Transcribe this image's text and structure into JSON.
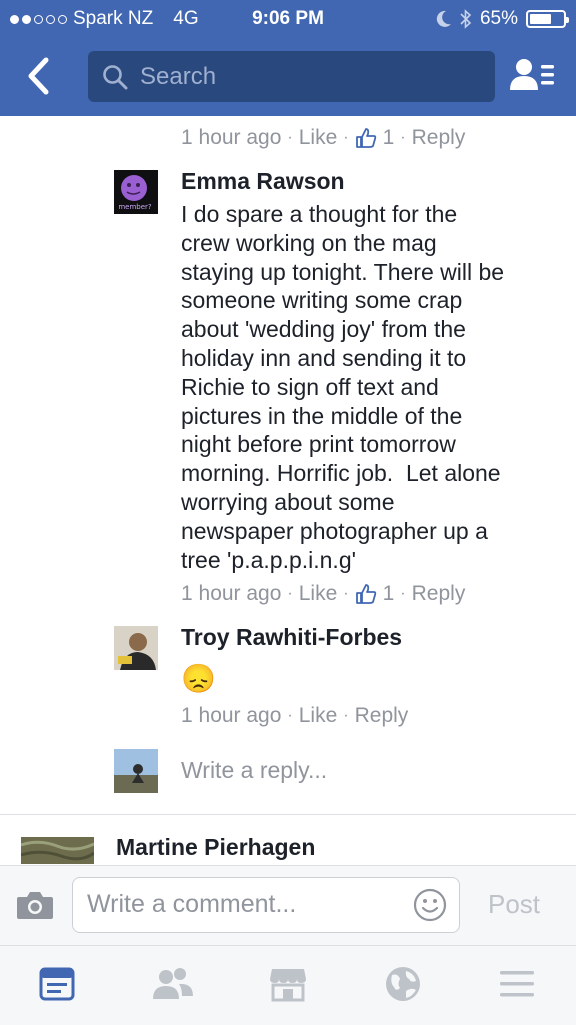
{
  "status_bar": {
    "carrier": "Spark NZ",
    "network": "4G",
    "time": "9:06 PM",
    "battery": "65%",
    "battery_level": 0.65
  },
  "header": {
    "search_placeholder": "Search"
  },
  "top_meta": {
    "time": "1 hour ago",
    "like": "Like",
    "like_count": "1",
    "reply": "Reply"
  },
  "comments": [
    {
      "author": "Emma Rawson",
      "text_lines": [
        "I do spare a thought for the",
        "crew working on the mag",
        "staying up tonight. There will be",
        "someone writing some crap",
        "about 'wedding joy' from the",
        "holiday inn and sending it to",
        "Richie to sign off text and",
        "pictures in the middle of the",
        "night before print tomorrow",
        "morning. Horrific job.  Let alone",
        "worrying about some",
        "newspaper photographer up a",
        "tree 'p.a.p.p.i.n.g'"
      ],
      "time": "1 hour ago",
      "like": "Like",
      "like_count": "1",
      "reply": "Reply",
      "avatar_text": "member?"
    },
    {
      "author": "Troy Rawhiti-Forbes",
      "emoji": "😞",
      "time": "1 hour ago",
      "like": "Like",
      "reply": "Reply"
    }
  ],
  "reply_box": {
    "placeholder": "Write a reply..."
  },
  "next_comment": {
    "author": "Martine Pierhagen"
  },
  "composer": {
    "placeholder": "Write a comment...",
    "post_label": "Post"
  },
  "tabs": [
    "news-feed-icon",
    "friends-icon",
    "marketplace-icon",
    "globe-icon",
    "menu-icon"
  ],
  "colors": {
    "brand": "#4267b2",
    "active_tab": "#4267b2",
    "inactive_tab": "#bec3c9",
    "like_blue": "#4267b2"
  }
}
